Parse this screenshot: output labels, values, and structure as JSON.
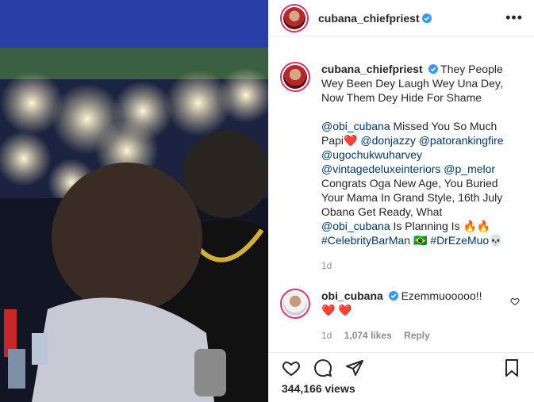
{
  "post": {
    "author": "cubana_chiefpriest",
    "more_label": "•••",
    "views": "344,166 views"
  },
  "caption": {
    "author": "cubana_chiefpriest",
    "line1": "They People Wey Been Dey Laugh Wey Una Dey, Now Them Dey Hide For Shame",
    "mention_obi": "@obi_cubana",
    "text2": " Missed You So Much Papi",
    "emoji_heart": "❤️",
    "mention_donjazzy": "@donjazzy",
    "mention_patoranking": "@patorankingfire",
    "mention_ugochukwu": "@ugochukwuharvey",
    "mention_vintage": "@vintagedeluxeinteriors",
    "mention_pmelor": "@p_melor",
    "text3": " Congrats Oga New Age, You Buried Your Mama In Grand Style, 16th July Obanɢ Get Ready, What ",
    "mention_obi2": "@obi_cubana",
    "text4": " Is Planning Is ",
    "emoji_fire": "🔥🔥",
    "hashtag1": "#CelebrityBarMan",
    "emoji_flag": "🇧🇷",
    "hashtag2": "#DrEzeMuo",
    "emoji_skull": "💀",
    "time": "1d"
  },
  "comment": {
    "author": "obi_cubana",
    "text": "Ezemmuooooo!!",
    "emoji": "❤️ ❤️",
    "time": "1d",
    "likes": "1,074 likes",
    "reply": "Reply"
  },
  "colors": {
    "link": "#00376b",
    "verified": "#3897f0",
    "heart": "#ed4956"
  }
}
